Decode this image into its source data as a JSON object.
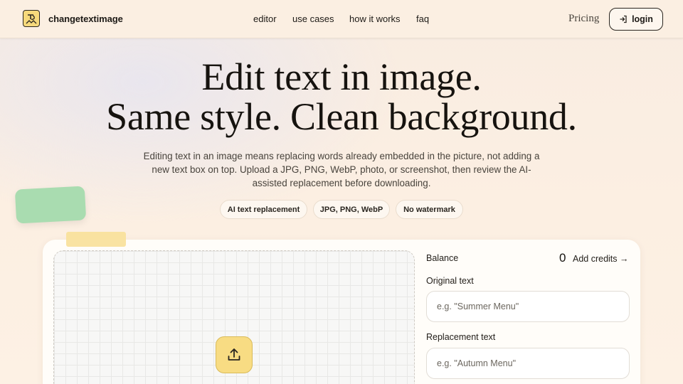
{
  "nav": {
    "brand": "changetextimage",
    "links": [
      {
        "label": "editor"
      },
      {
        "label": "use cases"
      },
      {
        "label": "how it works"
      },
      {
        "label": "faq"
      }
    ],
    "pricing": "Pricing",
    "login": "login"
  },
  "hero": {
    "title_line1": "Edit text in image.",
    "title_line2": "Same style. Clean background.",
    "subtitle": "Editing text in an image means replacing words already embedded in the picture, not adding a new text box on top. Upload a JPG, PNG, WebP, photo, or screenshot, then review the AI-assisted replacement before downloading.",
    "pills": [
      "AI text replacement",
      "JPG, PNG, WebP",
      "No watermark"
    ]
  },
  "editor": {
    "balance_label": "Balance",
    "balance_value": "0",
    "add_credits": "Add credits →",
    "original_label": "Original text",
    "original_placeholder": "e.g. \"Summer Menu\"",
    "replacement_label": "Replacement text",
    "replacement_placeholder": "e.g. \"Autumn Menu\""
  },
  "icons": {
    "logo": "logo-icon",
    "login": "login-icon",
    "upload": "upload-icon"
  },
  "colors": {
    "background": "#fcefe2",
    "accent_yellow": "#f8dc83",
    "decor_green": "#a9dcb0",
    "text": "#16130f"
  }
}
